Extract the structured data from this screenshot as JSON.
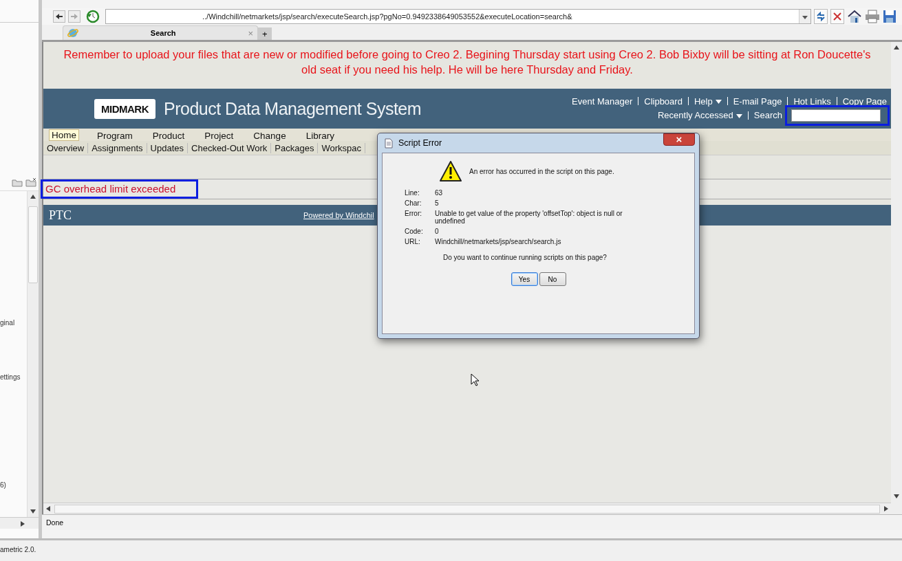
{
  "browser": {
    "address": "../Windchill/netmarkets/jsp/search/executeSearch.jsp?pgNo=0.9492338649053552&executeLocation=search&",
    "tab": {
      "title": "Search",
      "close": "×",
      "new_tab": "+"
    },
    "status": "Done"
  },
  "banner": "Remember to upload your files that are new or modified before going to Creo 2. Begining Thursday start using Creo 2. Bob Bixby will be sitting at Ron Doucette's old seat if you need his help. He will be here Thursday and Friday.",
  "header": {
    "logo": "MIDMARK",
    "title": "Product Data Management System",
    "links": [
      {
        "label": "Event Manager",
        "dropdown": false
      },
      {
        "label": "Clipboard",
        "dropdown": false
      },
      {
        "label": "Help",
        "dropdown": true
      },
      {
        "label": "E-mail Page",
        "dropdown": false
      },
      {
        "label": "Hot Links",
        "dropdown": false
      },
      {
        "label": "Copy Page",
        "dropdown": false
      }
    ],
    "recent": {
      "label": "Recently Accessed",
      "dropdown": true
    },
    "search_label": "Search",
    "search_highlighted": true
  },
  "menu": [
    {
      "label": "Home",
      "selected": true
    },
    {
      "label": "Program",
      "selected": false
    },
    {
      "label": "Product",
      "selected": false
    },
    {
      "label": "Project",
      "selected": false
    },
    {
      "label": "Change",
      "selected": false
    },
    {
      "label": "Library",
      "selected": false
    }
  ],
  "submenu": [
    "Overview",
    "Assignments",
    "Updates",
    "Checked-Out Work",
    "Packages",
    "Workspac"
  ],
  "message": {
    "text": "GC overhead limit exceeded",
    "highlighted": true
  },
  "footer": {
    "logo": "PTC",
    "link": "Powered by Windchil"
  },
  "dialog": {
    "title": "Script Error",
    "close": "×",
    "message": "An error has occurred in the script on this page.",
    "fields": [
      {
        "label": "Line:",
        "value": "63"
      },
      {
        "label": "Char:",
        "value": "5"
      },
      {
        "label": "Error:",
        "value": "Unable to get value of the property 'offsetTop': object is null or undefined"
      },
      {
        "label": "Code:",
        "value": "0"
      },
      {
        "label": "URL:",
        "value": "Windchill/netmarkets/jsp/search/search.js"
      }
    ],
    "question": "Do you want to continue running scripts on this page?",
    "buttons": [
      {
        "label": "Yes",
        "default": true
      },
      {
        "label": "No",
        "default": false
      }
    ]
  },
  "left_panel": {
    "texts": [
      "ginal",
      "ettings",
      "6)"
    ]
  },
  "bottom_text": "ametric 2.0."
}
